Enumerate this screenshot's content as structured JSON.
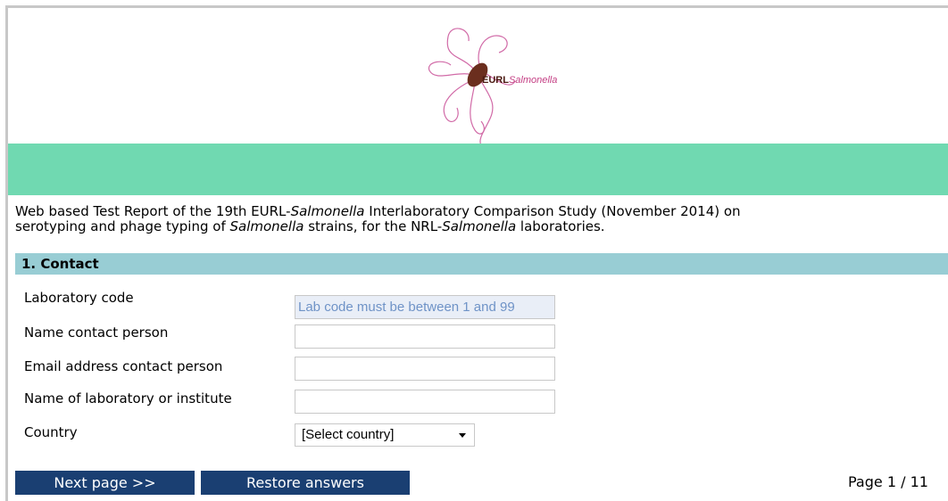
{
  "logo": {
    "brand_bold": "EURL",
    "brand_italic": "Salmonella",
    "colors": {
      "body": "#6b2e1e",
      "flagella": "#d16aa7"
    }
  },
  "intro": {
    "line1_a": "Web based Test Report of the 19th EURL-",
    "line1_b": "Salmonella",
    "line1_c": " Interlaboratory Comparison Study (November 2014) on",
    "line2_a": "serotyping and phage typing of ",
    "line2_b": "Salmonella",
    "line2_c": " strains, for the NRL-",
    "line2_d": "Salmonella",
    "line2_e": " laboratories."
  },
  "section": {
    "title": "1. Contact"
  },
  "form": {
    "lab_code": {
      "label": "Laboratory code",
      "placeholder": "Lab code must be between 1 and 99"
    },
    "name_contact": {
      "label": "Name contact person",
      "value": ""
    },
    "email_contact": {
      "label": "Email address contact person",
      "value": ""
    },
    "lab_name": {
      "label": "Name of laboratory or institute",
      "value": ""
    },
    "country": {
      "label": "Country",
      "selected": "[Select country]"
    }
  },
  "nav": {
    "next_label": "Next page >>",
    "restore_label": "Restore answers",
    "page_indicator": "Page 1 / 11"
  },
  "colors": {
    "green_band": "#70d9b1",
    "section_header": "#98cdd4",
    "button_bg": "#1a3f72"
  }
}
